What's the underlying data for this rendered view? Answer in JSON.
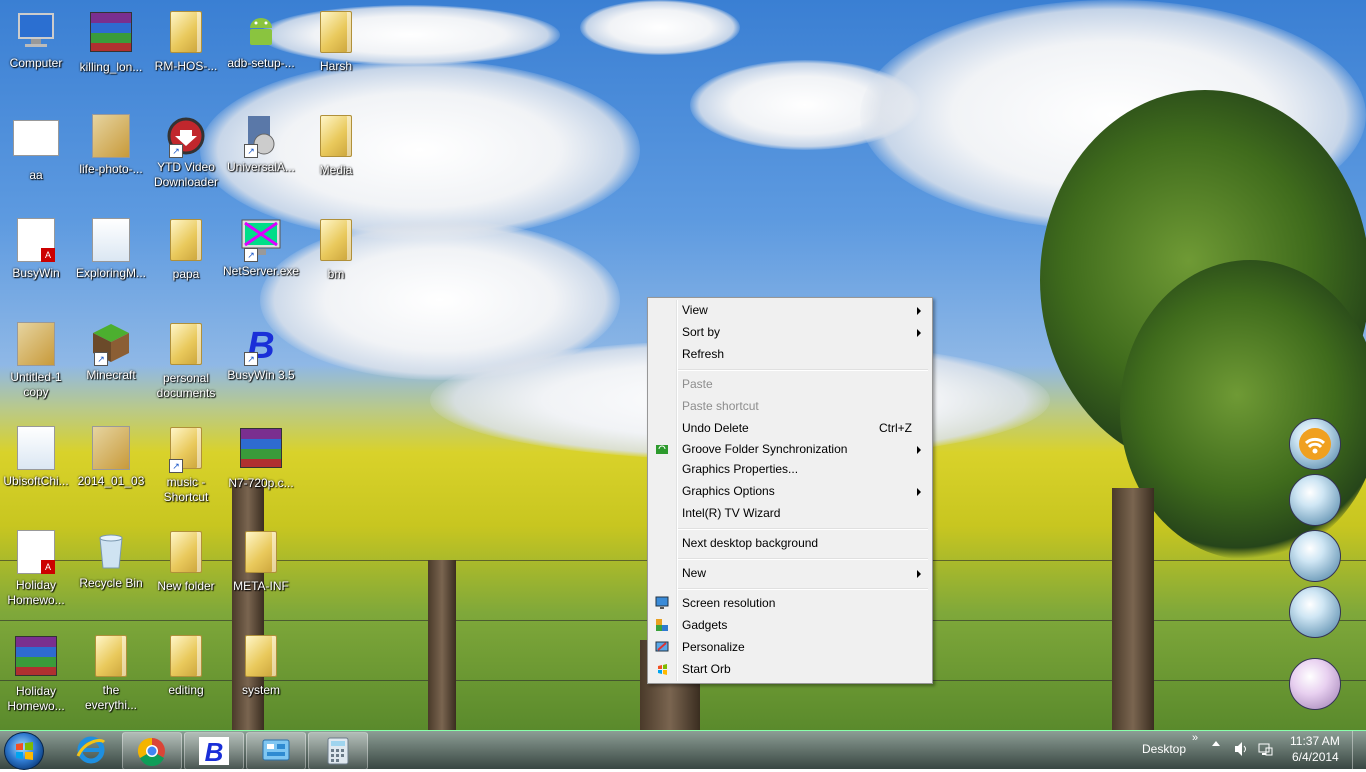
{
  "desktop_icons": [
    {
      "label": "Computer",
      "icon": "computer-icon"
    },
    {
      "label": "killing_lon...",
      "icon": "winrar-archive-icon"
    },
    {
      "label": "RM-HOS-...",
      "icon": "folder-icon"
    },
    {
      "label": "adb-setup-...",
      "icon": "android-icon"
    },
    {
      "label": "Harsh",
      "icon": "folder-icon"
    },
    {
      "label": "aa",
      "icon": "document-icon"
    },
    {
      "label": "life-photo-...",
      "icon": "image-icon"
    },
    {
      "label": "YTD Video\nDownloader",
      "icon": "ytd-downloader-icon"
    },
    {
      "label": "UniversalA...",
      "icon": "installer-icon"
    },
    {
      "label": "Media",
      "icon": "folder-icon"
    },
    {
      "label": "BusyWin",
      "icon": "pdf-icon"
    },
    {
      "label": "ExploringM...",
      "icon": "file-icon"
    },
    {
      "label": "papa",
      "icon": "folder-icon"
    },
    {
      "label": "NetServer.exe",
      "icon": "monitor-app-icon"
    },
    {
      "label": "bm",
      "icon": "folder-icon"
    },
    {
      "label": "Untitled-1\ncopy",
      "icon": "image-icon"
    },
    {
      "label": "Minecraft",
      "icon": "minecraft-icon"
    },
    {
      "label": "personal\ndocuments",
      "icon": "folder-icon"
    },
    {
      "label": "BusyWin 3.5",
      "icon": "busywin-icon"
    },
    {
      "label": "UbisoftChi...",
      "icon": "file-icon"
    },
    {
      "label": "2014_01_03",
      "icon": "image-icon"
    },
    {
      "label": "music -\nShortcut",
      "icon": "folder-icon"
    },
    {
      "label": "N7-720p.c...",
      "icon": "winrar-archive-icon"
    },
    {
      "label": "Holiday\nHomewo...",
      "icon": "pdf-icon"
    },
    {
      "label": "Recycle Bin",
      "icon": "recycle-bin-icon"
    },
    {
      "label": "New folder",
      "icon": "folder-icon"
    },
    {
      "label": "META-INF",
      "icon": "folder-icon"
    },
    {
      "label": "Holiday\nHomewo...",
      "icon": "winrar-archive-icon"
    },
    {
      "label": "the\neverythi...",
      "icon": "folder-icon"
    },
    {
      "label": "editing",
      "icon": "folder-icon"
    },
    {
      "label": "system",
      "icon": "folder-icon"
    }
  ],
  "context_menu": {
    "items": [
      {
        "label": "View",
        "submenu": true
      },
      {
        "label": "Sort by",
        "submenu": true
      },
      {
        "label": "Refresh"
      },
      {
        "label": "Paste",
        "disabled": true
      },
      {
        "label": "Paste shortcut",
        "disabled": true
      },
      {
        "label": "Undo Delete",
        "shortcut": "Ctrl+Z"
      },
      {
        "label": "Groove Folder Synchronization",
        "submenu": true,
        "icon": "groove-sync-icon"
      },
      {
        "label": "Graphics Properties..."
      },
      {
        "label": "Graphics Options",
        "submenu": true
      },
      {
        "label": "Intel(R) TV Wizard"
      },
      {
        "label": "Next desktop background"
      },
      {
        "label": "New",
        "submenu": true
      },
      {
        "label": "Screen resolution",
        "icon": "screen-resolution-icon"
      },
      {
        "label": "Gadgets",
        "icon": "gadgets-icon"
      },
      {
        "label": "Personalize",
        "icon": "personalize-icon"
      },
      {
        "label": "Start Orb",
        "icon": "start-orb-icon"
      }
    ]
  },
  "taskbar": {
    "start_button": "windows-start-orb",
    "pinned": [
      {
        "name": "internet-explorer",
        "icon": "ie-icon"
      },
      {
        "name": "google-chrome",
        "icon": "chrome-icon"
      },
      {
        "name": "busywin",
        "icon": "busywin-icon"
      },
      {
        "name": "control-panel",
        "icon": "control-panel-icon"
      },
      {
        "name": "calculator",
        "icon": "calculator-icon"
      }
    ],
    "toolbar_label": "Desktop",
    "overflow_chevron": "»",
    "time": "11:37 AM",
    "date": "6/4/2014"
  },
  "colors": {
    "menu_bg": "#f0f0f0",
    "menu_disabled": "#8d8d8d",
    "taskbar": "#2f403a"
  }
}
